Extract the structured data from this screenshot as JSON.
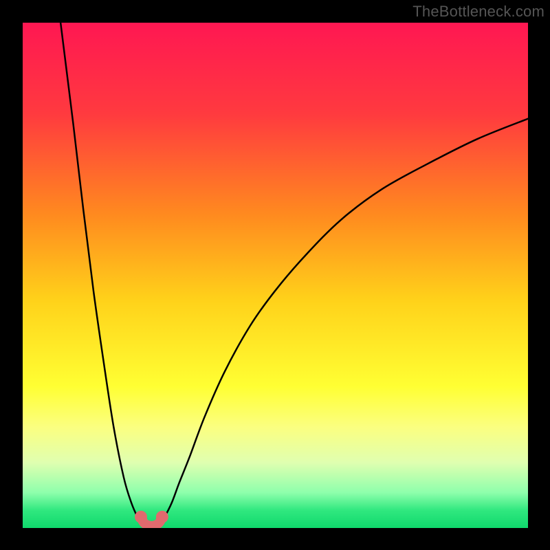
{
  "watermark": "TheBottleneck.com",
  "chart_data": {
    "type": "line",
    "title": "",
    "xlabel": "",
    "ylabel": "",
    "xlim": [
      0,
      100
    ],
    "ylim": [
      0,
      100
    ],
    "grid": false,
    "legend": false,
    "background_gradient_stops": [
      {
        "pos": 0.0,
        "color": "#ff1752"
      },
      {
        "pos": 0.18,
        "color": "#ff3a3f"
      },
      {
        "pos": 0.38,
        "color": "#ff8a1f"
      },
      {
        "pos": 0.55,
        "color": "#ffd21a"
      },
      {
        "pos": 0.72,
        "color": "#ffff33"
      },
      {
        "pos": 0.8,
        "color": "#fbff80"
      },
      {
        "pos": 0.87,
        "color": "#e0ffb0"
      },
      {
        "pos": 0.93,
        "color": "#8effac"
      },
      {
        "pos": 0.965,
        "color": "#30e87f"
      },
      {
        "pos": 1.0,
        "color": "#0fd86c"
      }
    ],
    "series": [
      {
        "name": "curve-left",
        "color": "#000000",
        "x": [
          7.5,
          8.5,
          10,
          12,
          14,
          16,
          18,
          20,
          21.5,
          22.8,
          23.6
        ],
        "y": [
          100,
          92,
          80,
          63,
          47,
          33,
          20,
          10,
          5,
          2,
          0.8
        ]
      },
      {
        "name": "curve-right",
        "color": "#000000",
        "x": [
          27.2,
          28,
          29.5,
          31,
          33,
          36,
          40,
          45,
          50,
          56,
          63,
          71,
          80,
          90,
          100
        ],
        "y": [
          0.8,
          2,
          5,
          9,
          14,
          22,
          31,
          40,
          47,
          54,
          61,
          67,
          72,
          77,
          81
        ]
      },
      {
        "name": "valley-marker",
        "color": "#e06a6e",
        "points": [
          {
            "x": 23.4,
            "y": 2.2
          },
          {
            "x": 23.8,
            "y": 1.3
          },
          {
            "x": 24.4,
            "y": 0.7
          },
          {
            "x": 25.5,
            "y": 0.4
          },
          {
            "x": 26.6,
            "y": 0.7
          },
          {
            "x": 27.2,
            "y": 1.3
          },
          {
            "x": 27.6,
            "y": 2.2
          }
        ]
      }
    ]
  }
}
